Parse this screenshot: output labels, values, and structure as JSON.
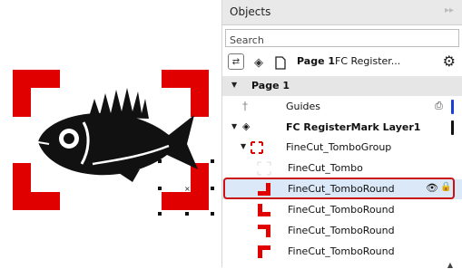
{
  "canvas": {
    "mark_color": "#e00000"
  },
  "panel": {
    "title": "Objects",
    "collapse_icon": "double-chevron-right-icon",
    "search_placeholder": "Search",
    "page_label": "Page 1",
    "layer_label": "FC Register...",
    "tree": {
      "page_row": "Page 1",
      "guides": "Guides",
      "layer": "FC RegisterMark Layer1",
      "group": "FineCut_TomboGroup",
      "items": [
        "FineCut_Tombo",
        "FineCut_TomboRound",
        "FineCut_TomboRound",
        "FineCut_TomboRound",
        "FineCut_TomboRound"
      ]
    },
    "colors": {
      "guides_bar": "#1a3fd6",
      "layer_bar": "#111111",
      "highlight": "#cc1111"
    }
  }
}
